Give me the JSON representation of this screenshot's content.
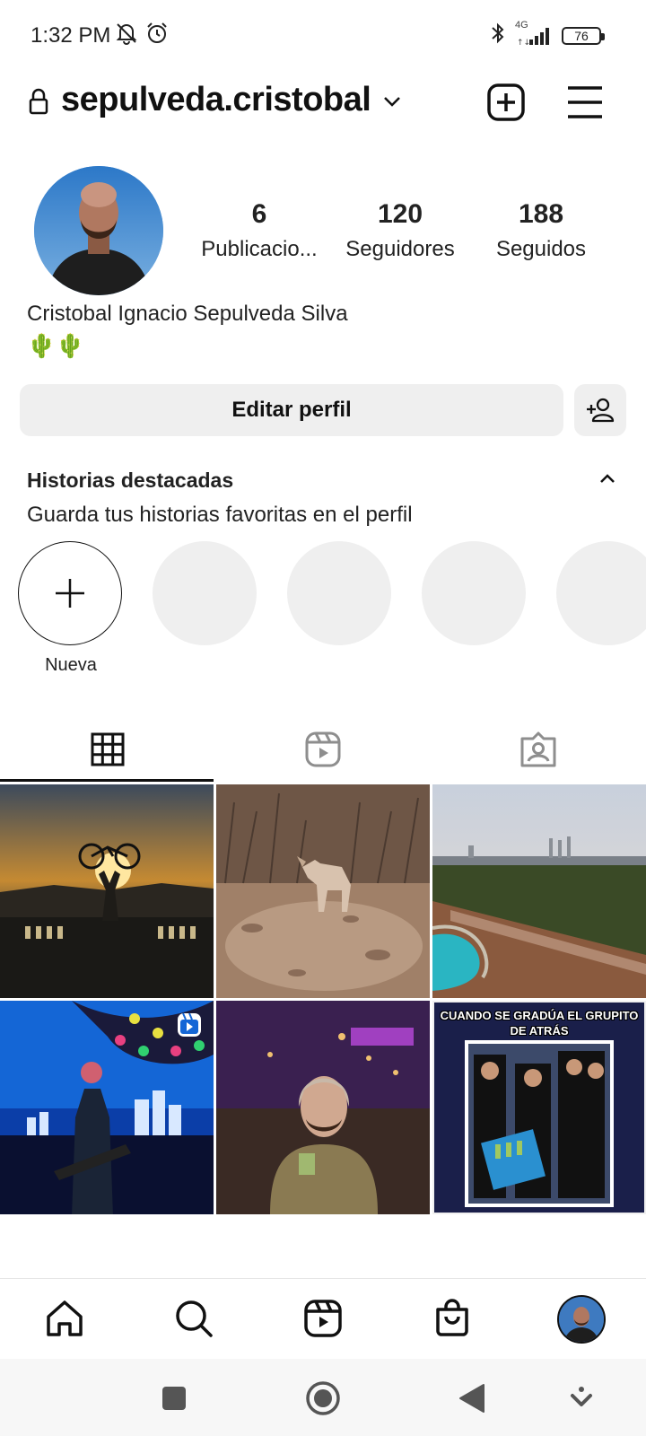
{
  "status_bar": {
    "time": "1:32 PM",
    "network": "4G",
    "battery": "76",
    "icons": [
      "mute-bell-icon",
      "alarm-icon",
      "bluetooth-icon",
      "signal-icon",
      "battery-icon"
    ]
  },
  "header": {
    "username": "sepulveda.cristobal",
    "icons": [
      "lock-icon",
      "chevron-down-icon",
      "new-post-icon",
      "menu-icon"
    ]
  },
  "profile": {
    "stats": [
      {
        "value": "6",
        "label": "Publicacio..."
      },
      {
        "value": "120",
        "label": "Seguidores"
      },
      {
        "value": "188",
        "label": "Seguidos"
      }
    ],
    "full_name": "Cristobal Ignacio Sepulveda Silva",
    "bio": "🌵🌵",
    "edit_button": "Editar perfil"
  },
  "highlights": {
    "title": "Historias destacadas",
    "subtitle": "Guarda tus historias favoritas en el perfil",
    "new_label": "Nueva"
  },
  "tabs": [
    "grid-icon",
    "reels-icon",
    "tagged-icon"
  ],
  "posts": [
    {
      "type": "photo",
      "subject": "sunset-bicycle"
    },
    {
      "type": "photo",
      "subject": "fox-desert"
    },
    {
      "type": "photo",
      "subject": "aerial-coast"
    },
    {
      "type": "reel",
      "subject": "guitarist-stage"
    },
    {
      "type": "photo",
      "subject": "man-night-bar"
    },
    {
      "type": "photo",
      "subject": "graduation-meme",
      "caption": "CUANDO SE GRADÚA EL GRUPITO DE ATRÁS"
    }
  ],
  "bottom_nav": [
    "home-icon",
    "search-icon",
    "reels-icon",
    "shop-icon",
    "profile-avatar"
  ],
  "colors": {
    "text": "#111111",
    "button_bg": "#efefef",
    "highlight_placeholder": "#efefef"
  }
}
